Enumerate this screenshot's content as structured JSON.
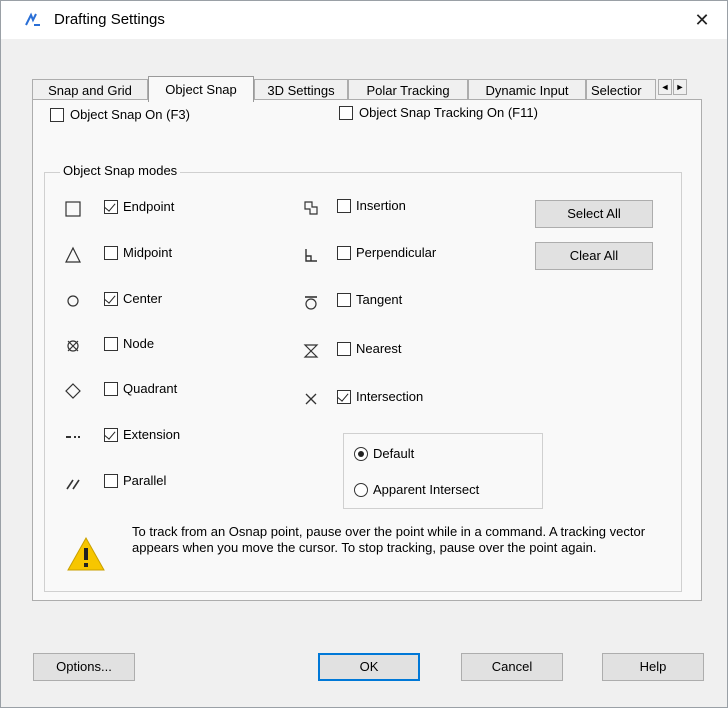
{
  "window": {
    "title": "Drafting Settings",
    "close_glyph": "✕"
  },
  "tabs": [
    {
      "label": "Snap and Grid",
      "active": false
    },
    {
      "label": "Object Snap",
      "active": true
    },
    {
      "label": "3D Settings",
      "active": false
    },
    {
      "label": "Polar Tracking",
      "active": false
    },
    {
      "label": "Dynamic Input",
      "active": false
    },
    {
      "label": "Selectior",
      "active": false
    }
  ],
  "tab_scroll": {
    "left": "◄",
    "right": "►"
  },
  "object_snap_on": {
    "label": "Object Snap On (F3)",
    "checked": false
  },
  "object_snap_tracking_on": {
    "label": "Object Snap Tracking On (F11)",
    "checked": false
  },
  "modes_group_title": "Object Snap modes",
  "modes_left": [
    {
      "label": "Endpoint",
      "checked": true,
      "icon": "square-icon"
    },
    {
      "label": "Midpoint",
      "checked": false,
      "icon": "triangle-icon"
    },
    {
      "label": "Center",
      "checked": true,
      "icon": "circle-icon"
    },
    {
      "label": "Node",
      "checked": false,
      "icon": "node-icon"
    },
    {
      "label": "Quadrant",
      "checked": false,
      "icon": "diamond-icon"
    },
    {
      "label": "Extension",
      "checked": true,
      "icon": "extension-icon"
    },
    {
      "label": "Parallel",
      "checked": false,
      "icon": "parallel-icon"
    }
  ],
  "modes_right": [
    {
      "label": "Insertion",
      "checked": false,
      "icon": "insertion-icon"
    },
    {
      "label": "Perpendicular",
      "checked": false,
      "icon": "perpendicular-icon"
    },
    {
      "label": "Tangent",
      "checked": false,
      "icon": "tangent-icon"
    },
    {
      "label": "Nearest",
      "checked": false,
      "icon": "nearest-icon"
    },
    {
      "label": "Intersection",
      "checked": true,
      "icon": "intersection-icon"
    }
  ],
  "buttons": {
    "select_all": "Select All",
    "clear_all": "Clear All",
    "options": "Options...",
    "ok": "OK",
    "cancel": "Cancel",
    "help": "Help"
  },
  "intersection_options": [
    {
      "label": "Default",
      "selected": true
    },
    {
      "label": "Apparent Intersect",
      "selected": false
    }
  ],
  "info_text": "To track from an Osnap point, pause over the point while in a command. A tracking vector appears when you move the cursor. To stop tracking, pause over the point again.",
  "colors": {
    "accent": "#0078d7",
    "warning": "#f7c600"
  }
}
